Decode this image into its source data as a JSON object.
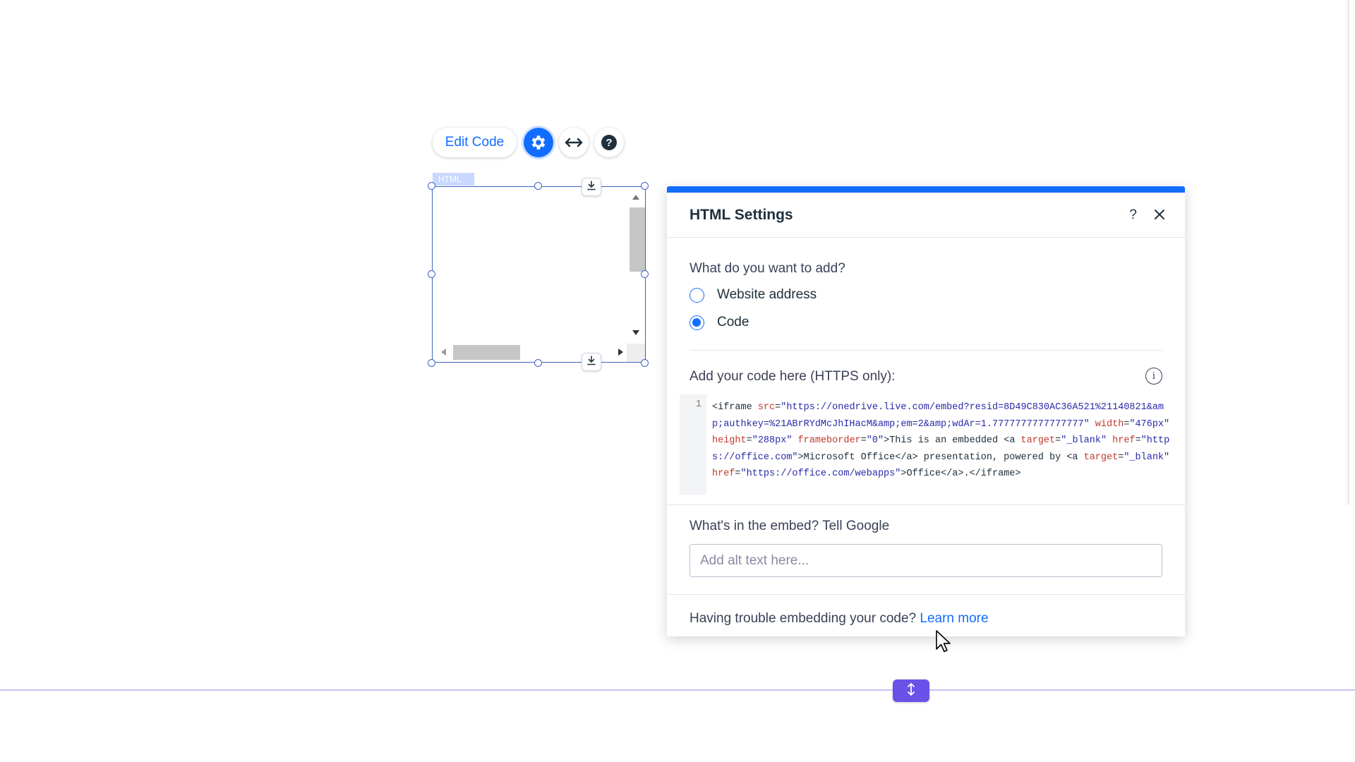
{
  "toolbar": {
    "edit_code_label": "Edit Code",
    "settings_icon": "gear-icon",
    "stretch_icon": "double-arrow-icon",
    "help_icon": "help-icon"
  },
  "component": {
    "tag_label": "HTML"
  },
  "panel": {
    "title": "HTML Settings",
    "help_label": "?",
    "question": "What do you want to add?",
    "options": [
      {
        "label": "Website address",
        "selected": false
      },
      {
        "label": "Code",
        "selected": true
      }
    ],
    "code_label": "Add your code here (HTTPS only):",
    "info_label": "i",
    "code_line_number": "1",
    "code_parts": {
      "p1": "<iframe ",
      "p2": "src",
      "p3": "=",
      "p4": "\"https://onedrive.live.com/embed?resid=8D49C830AC36A521%21140821&amp;authkey=%21ABrRYdMcJhIHacM&amp;em=2&amp;wdAr=1.7777777777777777\"",
      "p5": " ",
      "p6": "width",
      "p7": "=",
      "p8": "\"476px\"",
      "p9": " ",
      "p10": "height",
      "p11": "=",
      "p12": "\"288px\"",
      "p13": " ",
      "p14": "frameborder",
      "p15": "=",
      "p16": "\"0\"",
      "p17": ">This is an embedded <a ",
      "p18": "target",
      "p19": "=",
      "p20": "\"_blank\"",
      "p21": " ",
      "p22": "href",
      "p23": "=",
      "p24": "\"https://office.com\"",
      "p25": ">Microsoft Office</a> presentation, powered by <a ",
      "p26": "target",
      "p27": "=",
      "p28": "\"_blank\"",
      "p29": " ",
      "p30": "href",
      "p31": "=",
      "p32": "\"https://office.com/webapps\"",
      "p33": ">Office</a>.</iframe>"
    },
    "alt_label": "What's in the embed? Tell Google",
    "alt_placeholder": "Add alt text here...",
    "alt_value": "",
    "trouble_text": "Having trouble embedding your code?",
    "learn_more": "Learn more"
  },
  "colors": {
    "accent": "#116dff",
    "section_button": "#6a52e8"
  }
}
